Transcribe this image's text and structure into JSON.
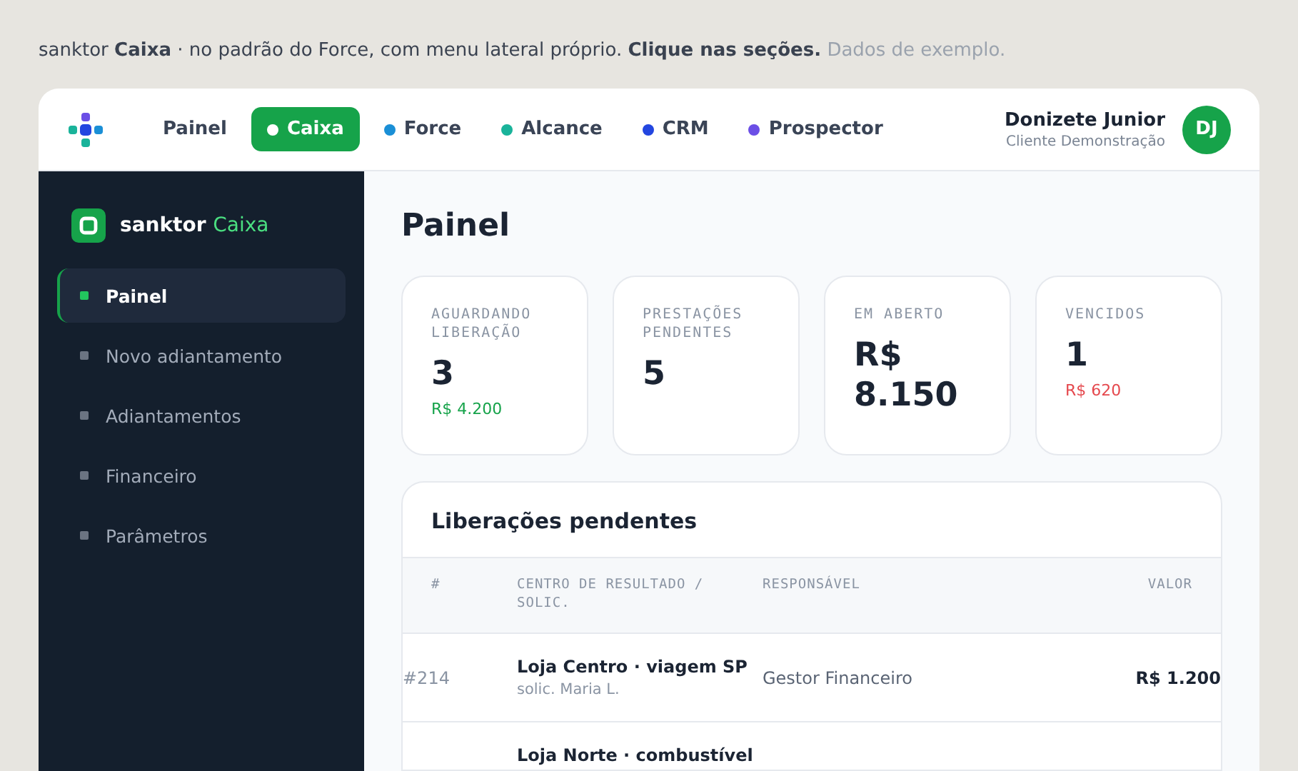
{
  "intro": {
    "text": "sanktor **Caixa** · no padrão do Force, com menu lateral próprio. **Clique nas seções.**",
    "note": "Dados de exemplo."
  },
  "topbar": {
    "tabs": [
      {
        "label": "Painel",
        "selected": false
      },
      {
        "label": "Caixa",
        "selected": true,
        "color": "#ffffff"
      },
      {
        "label": "Force",
        "selected": false,
        "color": "#1a8fd6"
      },
      {
        "label": "Alcance",
        "selected": false,
        "color": "#19b39a"
      },
      {
        "label": "CRM",
        "selected": false,
        "color": "#2346e0"
      },
      {
        "label": "Prospector",
        "selected": false,
        "color": "#6b4fe6"
      }
    ],
    "user": {
      "name": "Donizete Junior",
      "role": "Cliente Demonstração",
      "initials": "DJ"
    }
  },
  "sidebar": {
    "brand": "sanktor",
    "product": "Caixa",
    "items": [
      {
        "label": "Painel",
        "selected": true
      },
      {
        "label": "Novo adiantamento",
        "selected": false
      },
      {
        "label": "Adiantamentos",
        "selected": false
      },
      {
        "label": "Financeiro",
        "selected": false
      },
      {
        "label": "Parâmetros",
        "selected": false
      }
    ]
  },
  "page_title": "Painel",
  "stats": [
    {
      "label": "AGUARDANDO LIBERAÇÃO",
      "value": "3",
      "sub": "R$ 4.200",
      "color": "#16a34a"
    },
    {
      "label": "PRESTAÇÕES PENDENTES",
      "value": "5"
    },
    {
      "label": "EM ABERTO",
      "value": "R$ 8.150"
    },
    {
      "label": "VENCIDOS",
      "value": "1",
      "sub": "R$ 620",
      "color": "#e5484d"
    }
  ],
  "table": {
    "title": "Liberações pendentes",
    "columns": [
      "#",
      "CENTRO DE RESULTADO / SOLIC.",
      "RESPONSÁVEL",
      "VALOR"
    ],
    "rows": [
      {
        "id": "#214",
        "center": "Loja Centro · viagem SP",
        "requester": "solic. Maria L.",
        "responsible": "Gestor Financeiro",
        "value": "R$ 1.200"
      },
      {
        "center": "Loja Norte · combustível"
      }
    ]
  }
}
